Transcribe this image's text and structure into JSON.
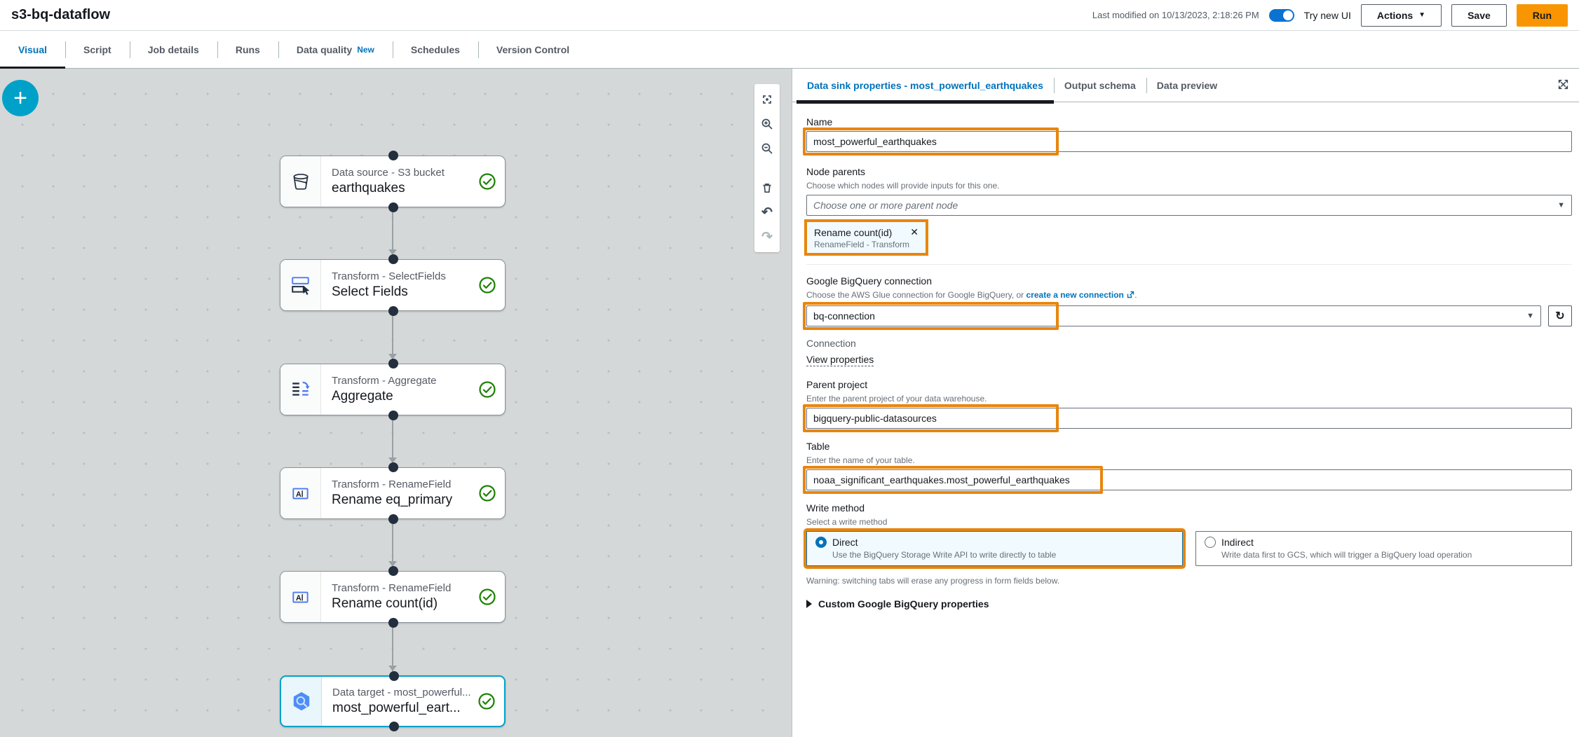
{
  "header": {
    "title": "s3-bq-dataflow",
    "last_modified": "Last modified on 10/13/2023, 2:18:26 PM",
    "toggle_label": "Try new UI",
    "actions_label": "Actions",
    "save_label": "Save",
    "run_label": "Run"
  },
  "tabs": [
    {
      "label": "Visual"
    },
    {
      "label": "Script"
    },
    {
      "label": "Job details"
    },
    {
      "label": "Runs"
    },
    {
      "label": "Data quality",
      "badge": "New"
    },
    {
      "label": "Schedules"
    },
    {
      "label": "Version Control"
    }
  ],
  "canvas": {
    "add_button": "+",
    "toolbar_icons": [
      "fit-view",
      "zoom-in",
      "zoom-out",
      "delete",
      "undo",
      "redo"
    ],
    "undo_glyph": "↶",
    "redo_glyph": "↷",
    "nodes": [
      {
        "type": "Data source - S3 bucket",
        "name": "earthquakes",
        "icon": "s3-bucket-icon",
        "status": "success"
      },
      {
        "type": "Transform - SelectFields",
        "name": "Select Fields",
        "icon": "select-fields-icon",
        "status": "success"
      },
      {
        "type": "Transform - Aggregate",
        "name": "Aggregate",
        "icon": "aggregate-icon",
        "status": "success"
      },
      {
        "type": "Transform - RenameField",
        "name": "Rename eq_primary",
        "icon": "rename-field-icon",
        "status": "success"
      },
      {
        "type": "Transform - RenameField",
        "name": "Rename count(id)",
        "icon": "rename-field-icon",
        "status": "success"
      },
      {
        "type": "Data target - most_powerful...",
        "name": "most_powerful_eart...",
        "icon": "bigquery-icon",
        "status": "success",
        "selected": true
      }
    ]
  },
  "panel": {
    "tabs": [
      {
        "label": "Data sink properties - most_powerful_earthquakes"
      },
      {
        "label": "Output schema"
      },
      {
        "label": "Data preview"
      }
    ],
    "name_field": {
      "label": "Name",
      "value": "most_powerful_earthquakes"
    },
    "node_parents": {
      "label": "Node parents",
      "description": "Choose which nodes will provide inputs for this one.",
      "placeholder": "Choose one or more parent node",
      "selected_tag": {
        "title": "Rename count(id)",
        "remove_glyph": "✕",
        "subtitle": "RenameField - Transform"
      }
    },
    "bigquery_connection": {
      "label": "Google BigQuery connection",
      "description_prefix": "Choose the AWS Glue connection for Google BigQuery, or ",
      "link_text": "create a new connection",
      "description_suffix": ".",
      "value": "bq-connection",
      "refresh_glyph": "↻",
      "connection_label": "Connection",
      "view_properties_label": "View properties"
    },
    "parent_project": {
      "label": "Parent project",
      "description": "Enter the parent project of your data warehouse.",
      "value": "bigquery-public-datasources"
    },
    "table": {
      "label": "Table",
      "description": "Enter the name of your table.",
      "value": "noaa_significant_earthquakes.most_powerful_earthquakes"
    },
    "write_method": {
      "label": "Write method",
      "description": "Select a write method",
      "options": [
        {
          "title": "Direct",
          "description": "Use the BigQuery Storage Write API to write directly to table",
          "selected": true
        },
        {
          "title": "Indirect",
          "description": "Write data first to GCS, which will trigger a BigQuery load operation",
          "selected": false
        }
      ]
    },
    "warning": "Warning: switching tabs will erase any progress in form fields below.",
    "custom_properties_label": "Custom Google BigQuery properties"
  },
  "colors": {
    "highlight_orange": "#e8860e",
    "run_button_orange": "#f89500",
    "accent_blue": "#0073bb",
    "selected_node_blue": "#00a1c9",
    "success_green": "#1d8102"
  }
}
